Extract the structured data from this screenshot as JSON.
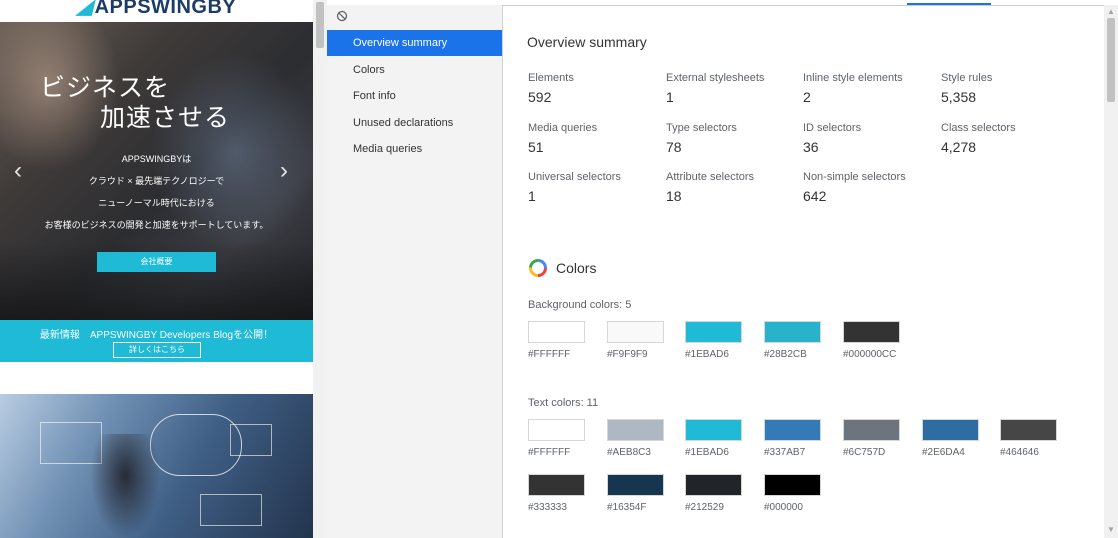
{
  "website": {
    "logo": "APPSWINGBY",
    "hero_line1": "ビジネスを",
    "hero_line2": "加速させる",
    "hero_text": [
      "APPSWINGBYは",
      "クラウド × 最先端テクノロジーで",
      "ニューノーマル時代における",
      "お客様のビジネスの開発と加速をサポートしています。"
    ],
    "hero_button": "会社概要",
    "news_text": "最新情報　APPSWINGBY Developers Blogを公開！",
    "news_button": "詳しくはこちら",
    "arrow_left_icon": "chevron-left-icon",
    "arrow_right_icon": "chevron-right-icon",
    "brand_color": "#1EBAD6"
  },
  "devtools": {
    "clear_icon": "clear-circle-icon",
    "accent_color": "#1A73E8",
    "sidebar": {
      "items": [
        {
          "label": "Overview summary",
          "active": true
        },
        {
          "label": "Colors",
          "active": false
        },
        {
          "label": "Font info",
          "active": false
        },
        {
          "label": "Unused declarations",
          "active": false
        },
        {
          "label": "Media queries",
          "active": false
        }
      ]
    },
    "overview": {
      "title": "Overview summary",
      "stats": [
        {
          "label": "Elements",
          "value": "592"
        },
        {
          "label": "External stylesheets",
          "value": "1"
        },
        {
          "label": "Inline style elements",
          "value": "2"
        },
        {
          "label": "Style rules",
          "value": "5,358"
        },
        {
          "label": "Media queries",
          "value": "51"
        },
        {
          "label": "Type selectors",
          "value": "78"
        },
        {
          "label": "ID selectors",
          "value": "36"
        },
        {
          "label": "Class selectors",
          "value": "4,278"
        },
        {
          "label": "Universal selectors",
          "value": "1"
        },
        {
          "label": "Attribute selectors",
          "value": "18"
        },
        {
          "label": "Non-simple selectors",
          "value": "642"
        }
      ]
    },
    "colors": {
      "title": "Colors",
      "icon": "color-wheel-icon",
      "background_label": "Background colors: 5",
      "background": [
        "#FFFFFF",
        "#F9F9F9",
        "#1EBAD6",
        "#28B2CB",
        "#000000CC"
      ],
      "text_label": "Text colors: 11",
      "text": [
        "#FFFFFF",
        "#AEB8C3",
        "#1EBAD6",
        "#337AB7",
        "#6C757D",
        "#2E6DA4",
        "#464646",
        "#333333",
        "#16354F",
        "#212529",
        "#000000"
      ]
    }
  }
}
